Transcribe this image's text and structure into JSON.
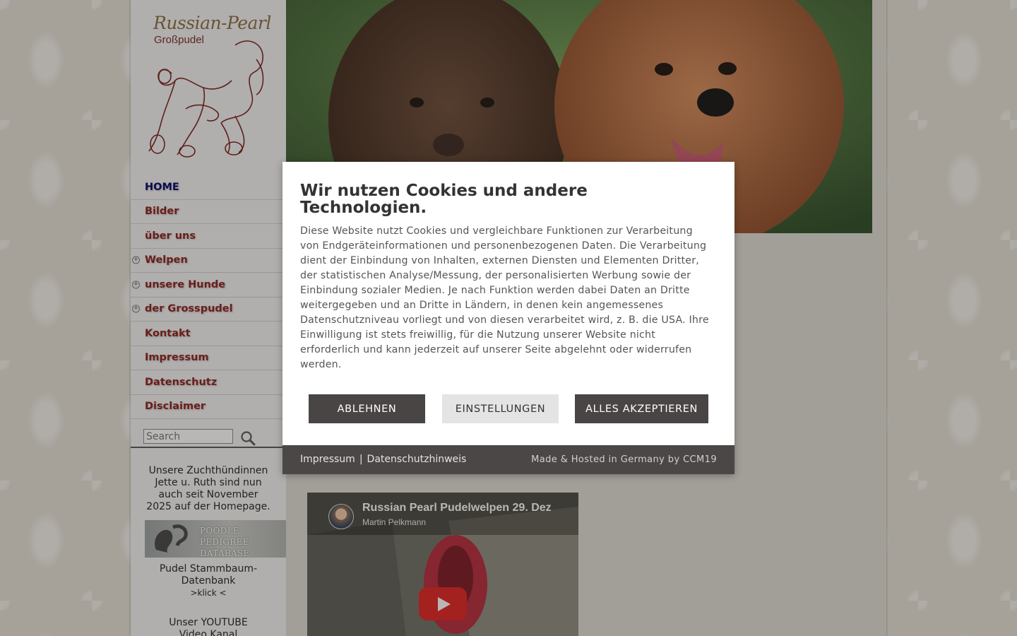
{
  "logo": {
    "title": "Russian-Pearl",
    "subtitle": "Großpudel"
  },
  "nav": {
    "items": [
      {
        "label": "HOME",
        "active": true,
        "expandable": false
      },
      {
        "label": "Bilder",
        "active": false,
        "expandable": false
      },
      {
        "label": "über uns",
        "active": false,
        "expandable": false
      },
      {
        "label": "Welpen",
        "active": false,
        "expandable": true
      },
      {
        "label": "unsere Hunde",
        "active": false,
        "expandable": true
      },
      {
        "label": "der Grosspudel",
        "active": false,
        "expandable": true
      },
      {
        "label": "Kontakt",
        "active": false,
        "expandable": false
      },
      {
        "label": "Impressum",
        "active": false,
        "expandable": false
      },
      {
        "label": "Datenschutz",
        "active": false,
        "expandable": false
      },
      {
        "label": "Disclaimer",
        "active": false,
        "expandable": false
      }
    ]
  },
  "search": {
    "placeholder": "Search",
    "icon": "search-icon"
  },
  "sidebar_content": {
    "announcement": "Unsere Zuchthündinnen Jette  u. Ruth  sind nun auch seit November 2025 auf der Homepage.",
    "pedigree_banner": "POODLE PEDIGREE DATABASE",
    "pedigree_caption": "Pudel Stammbaum-Datenbank",
    "pedigree_link": ">klick  <",
    "youtube_text": "Unser YOUTUBE Video Kanal"
  },
  "video": {
    "title": "Russian Pearl Pudelwelpen 29. Dez",
    "channel": "Martin Pelkmann"
  },
  "cookie_modal": {
    "heading": "Wir nutzen Cookies und andere Technologien.",
    "body": "Diese Website nutzt Cookies und vergleichbare Funktionen zur Verarbeitung von Endgeräteinformationen und personenbezogenen Daten. Die Verarbeitung dient der Einbindung von Inhalten, externen Diensten und Elementen Dritter, der statistischen Analyse/Messung, der personalisierten Werbung sowie der Einbindung sozialer Medien. Je nach Funktion werden dabei Daten an Dritte weitergegeben und an Dritte in Ländern, in denen kein angemessenes Datenschutzniveau vorliegt und von diesen verarbeitet wird, z. B. die USA. Ihre Einwilligung ist stets freiwillig, für die Nutzung unserer Website nicht erforderlich und kann jederzeit auf unserer Seite abgelehnt oder widerrufen werden.",
    "reject_label": "ABLEHNEN",
    "settings_label": "EINSTELLUNGEN",
    "accept_label": "ALLES AKZEPTIEREN",
    "footer_impressum": "Impressum",
    "footer_separator": "|",
    "footer_privacy": "Datenschutzhinweis",
    "footer_credit": "Made & Hosted in Germany by CCM19"
  },
  "colors": {
    "nav_text": "#8b1a1a",
    "nav_active": "#000066",
    "button_dark": "#484544",
    "button_light": "#e4e4e4",
    "footer_bg": "#4a4746"
  }
}
